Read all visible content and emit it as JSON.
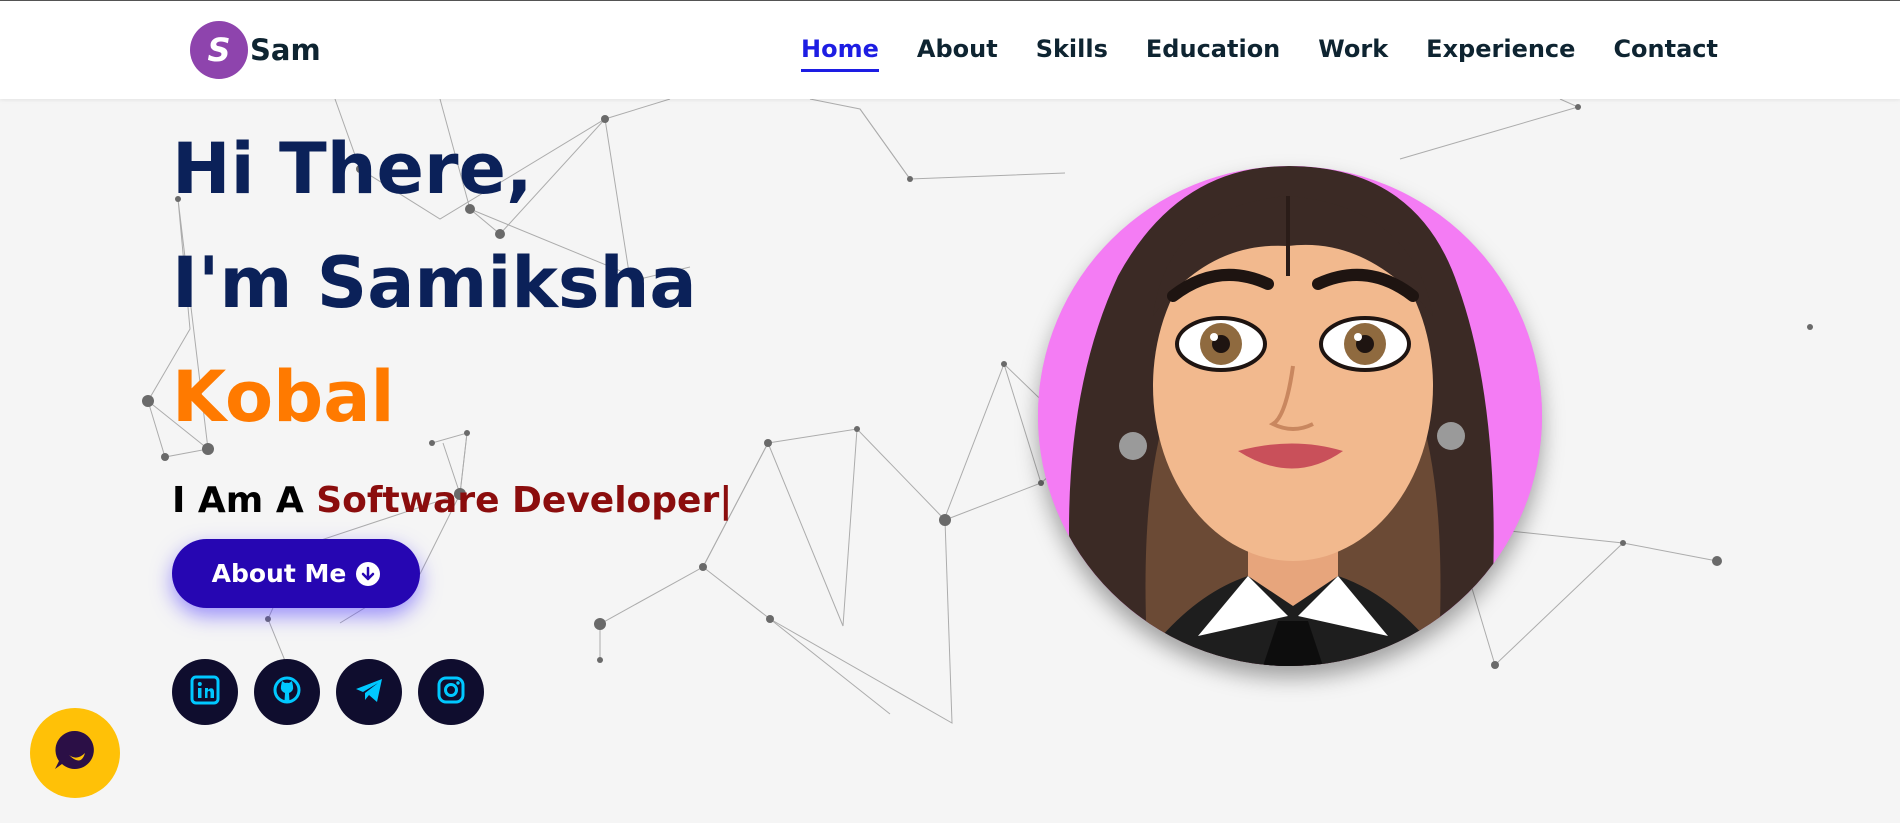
{
  "brand": {
    "initial": "S",
    "name": "Sam"
  },
  "nav": {
    "items": [
      {
        "label": "Home",
        "active": true
      },
      {
        "label": "About"
      },
      {
        "label": "Skills"
      },
      {
        "label": "Education"
      },
      {
        "label": "Work"
      },
      {
        "label": "Experience"
      },
      {
        "label": "Contact"
      }
    ]
  },
  "hero": {
    "greeting": "Hi There,",
    "line2": "I'm Samiksha",
    "line3": "Kobal",
    "role_prefix": "I Am A ",
    "role_typed": "Software Developer|",
    "about_button": "About Me",
    "socials": [
      {
        "icon": "linkedin-icon"
      },
      {
        "icon": "github-icon"
      },
      {
        "icon": "telegram-icon"
      },
      {
        "icon": "instagram-icon"
      }
    ]
  },
  "colors": {
    "heading": "#0b2159",
    "accent_orange": "#ff7a00",
    "typed_text": "#8b0d0d",
    "button": "#2606b2",
    "nav_active": "#1d1de3",
    "social_icon": "#00c8ff",
    "chat_button": "#ffc107",
    "avatar_bg": "#f47cf4"
  }
}
